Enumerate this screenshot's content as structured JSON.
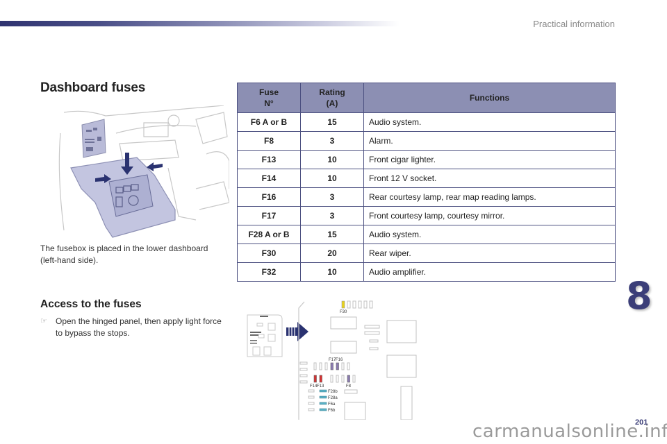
{
  "header": {
    "section_title": "Practical information"
  },
  "page": {
    "title": "Dashboard fuses",
    "description": "The fusebox is placed in the lower dashboard (left-hand side).",
    "access": {
      "title": "Access to the fuses",
      "bullet_icon": "pointing-hand-icon",
      "bullet_mark": "☞",
      "steps": [
        "Open the hinged panel, then apply light force to bypass the stops."
      ]
    },
    "chapter_number": "8",
    "page_number": "201",
    "watermark": "carmanualsonline.info"
  },
  "table": {
    "headers": {
      "fuse": "Fuse\nN°",
      "fuse_l1": "Fuse",
      "fuse_l2": "N°",
      "rating_l1": "Rating",
      "rating_l2": "(A)",
      "functions": "Functions"
    },
    "rows": [
      {
        "fuse": "F6 A or B",
        "rating": "15",
        "function": "Audio system."
      },
      {
        "fuse": "F8",
        "rating": "3",
        "function": "Alarm."
      },
      {
        "fuse": "F13",
        "rating": "10",
        "function": "Front cigar lighter."
      },
      {
        "fuse": "F14",
        "rating": "10",
        "function": "Front 12 V socket."
      },
      {
        "fuse": "F16",
        "rating": "3",
        "function": "Rear courtesy lamp, rear map reading lamps."
      },
      {
        "fuse": "F17",
        "rating": "3",
        "function": "Front courtesy lamp, courtesy mirror."
      },
      {
        "fuse": "F28 A or B",
        "rating": "15",
        "function": "Audio system."
      },
      {
        "fuse": "F30",
        "rating": "20",
        "function": "Rear wiper."
      },
      {
        "fuse": "F32",
        "rating": "10",
        "function": "Audio amplifier."
      }
    ]
  },
  "diagram": {
    "labels": {
      "f30": "F30",
      "f17": "F17",
      "f16": "F16",
      "f14": "F14",
      "f13": "F13",
      "f8": "F8",
      "f28b": "F28b",
      "f28a": "F28a",
      "f6a": "F6a",
      "f6b": "F6b"
    },
    "colors": {
      "yellow": "#e8d21a",
      "purple": "#8a7bb0",
      "red": "#d63030",
      "blue": "#5ab3c8",
      "arrow": "#2a3270"
    }
  },
  "colors": {
    "accent": "#3b3e78",
    "table_header": "#8c8fb3",
    "table_border": "#4b4f80"
  }
}
